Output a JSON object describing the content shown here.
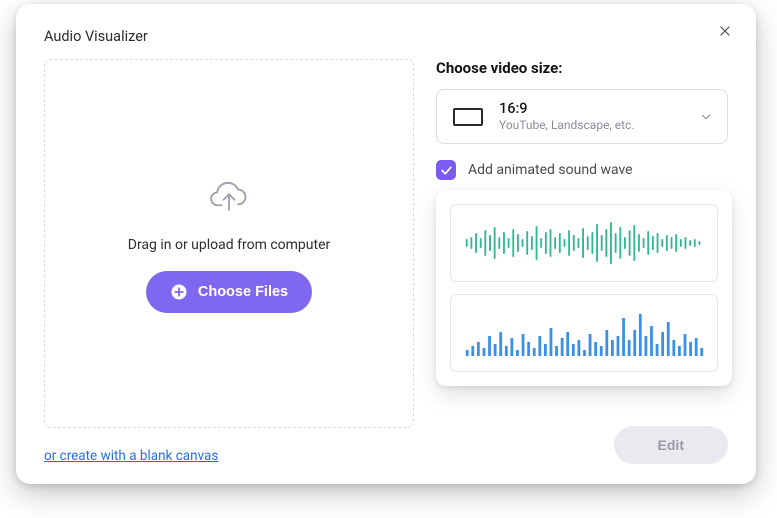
{
  "modal": {
    "title": "Audio Visualizer",
    "close_aria": "Close"
  },
  "drop": {
    "caption": "Drag in or upload from computer",
    "choose_label": "Choose Files"
  },
  "blank_canvas_link": "or create with a blank canvas",
  "size": {
    "heading": "Choose video size:",
    "selected_title": "16:9",
    "selected_sub": "YouTube, Landscape, etc."
  },
  "soundwave": {
    "checkbox_checked": true,
    "label": "Add animated sound wave"
  },
  "footer": {
    "edit_label": "Edit"
  },
  "colors": {
    "accent": "#8067f0",
    "wave_green": "#30b892",
    "wave_blue": "#3a90e8"
  }
}
